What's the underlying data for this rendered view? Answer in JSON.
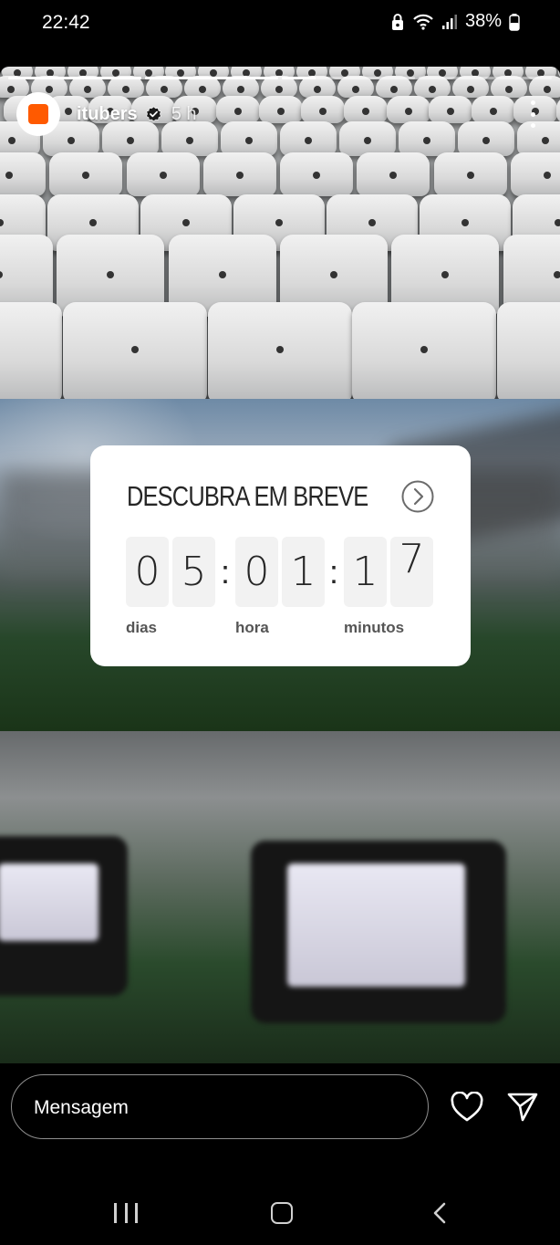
{
  "status_bar": {
    "time": "22:42",
    "battery": "38%",
    "icons": [
      "lock-icon",
      "wifi-icon",
      "signal-icon",
      "battery-icon"
    ]
  },
  "story": {
    "progress": [
      1,
      1,
      0.25,
      0
    ],
    "username": "itubers",
    "time_ago": "5 h",
    "verified": true,
    "avatar_color": "#ff5a00"
  },
  "countdown": {
    "title": "DESCUBRA EM BREVE",
    "digits": [
      "0",
      "5",
      "0",
      "1",
      "1",
      "7"
    ],
    "labels": {
      "days": "dias",
      "hours": "hora",
      "minutes": "minutos"
    }
  },
  "message_bar": {
    "placeholder": "Mensagem"
  },
  "colors": {
    "background": "#000000",
    "card": "#ffffff",
    "digit_bg": "#f2f2f2"
  }
}
